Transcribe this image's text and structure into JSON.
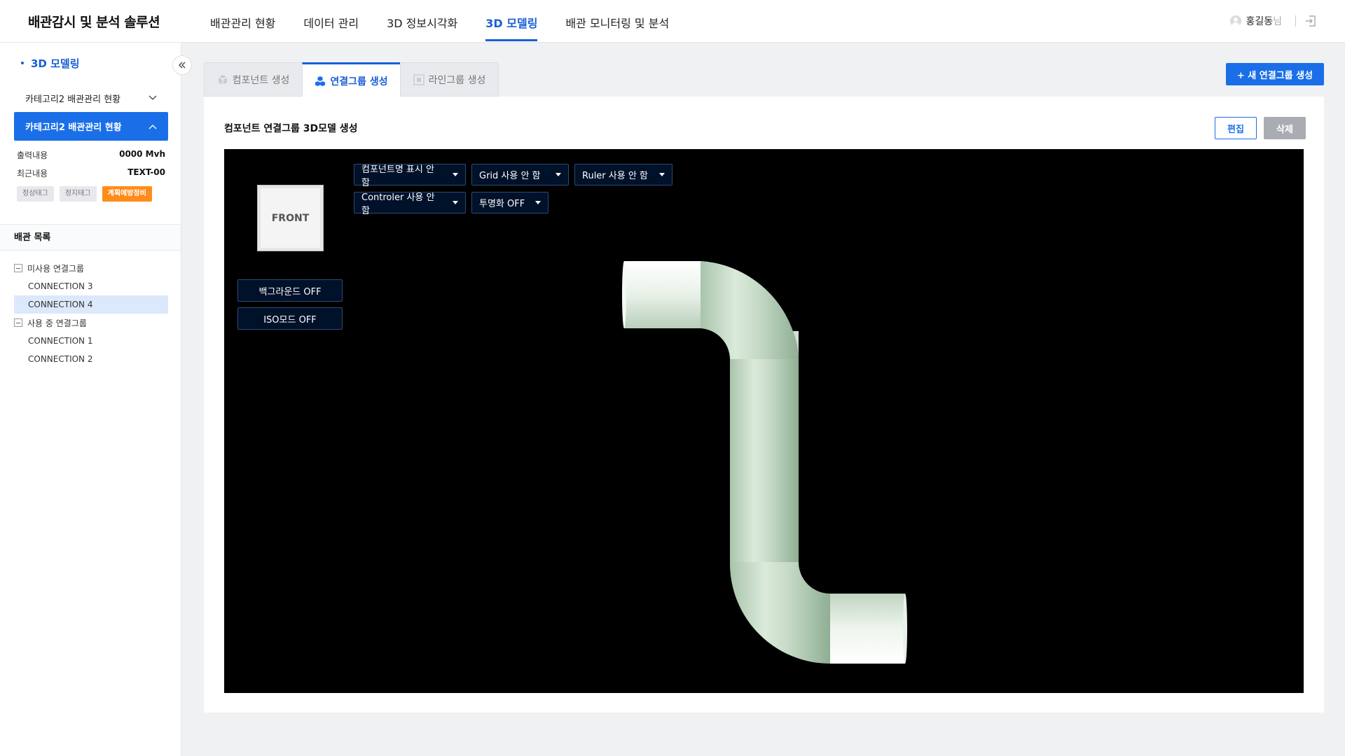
{
  "app": {
    "title": "배관감시 및 분석 솔루션"
  },
  "nav": {
    "items": [
      {
        "label": "배관관리 현황"
      },
      {
        "label": "데이터 관리"
      },
      {
        "label": "3D 정보시각화"
      },
      {
        "label": "3D 모델링"
      },
      {
        "label": "배관 모니터링 및 분석"
      }
    ],
    "active": "3D 모델링"
  },
  "user": {
    "name": "홍길동",
    "suffix": "님"
  },
  "sidebar": {
    "title": "3D 모델링",
    "category_plain": "카테고리2 배관관리 현황",
    "category_active": "카테고리2 배관관리 현황",
    "info": [
      {
        "label": "출력내용",
        "value": "0000 Mvh"
      },
      {
        "label": "최근내용",
        "value": "TEXT-00"
      }
    ],
    "tags": [
      "정상태그",
      "정지태그",
      "계획예방정비"
    ],
    "list_title": "배관 목록",
    "groups": [
      {
        "label": "미사용 연결그룹",
        "items": [
          "CONNECTION 3",
          "CONNECTION 4"
        ]
      },
      {
        "label": "사용 중 연결그룹",
        "items": [
          "CONNECTION 1",
          "CONNECTION 2"
        ]
      }
    ],
    "selected_item": "CONNECTION 4"
  },
  "tabs": [
    {
      "label": "컴포넌트 생성"
    },
    {
      "label": "연결그룹 생성"
    },
    {
      "label": "라인그룹 생성"
    }
  ],
  "active_tab": "연결그룹 생성",
  "new_button": "+ 새 연결그룹 생성",
  "panel": {
    "title": "컴포넌트 연결그룹 3D모델 생성",
    "edit": "편집",
    "delete": "삭제"
  },
  "viewer": {
    "cube_label": "FRONT",
    "dropdowns": [
      "컴포넌트명 표시 안 함",
      "Grid 사용 안 함",
      "Ruler 사용 안 함",
      "Controler 사용 안 함",
      "투명화 OFF"
    ],
    "buttons": [
      "백그라운드 OFF",
      "ISO모드 OFF"
    ]
  },
  "colors": {
    "accent": "#1a6fe8",
    "warning_tag": "#ff8c1a",
    "viewport_bg": "#000000",
    "pipe": "#c8dcc8"
  }
}
